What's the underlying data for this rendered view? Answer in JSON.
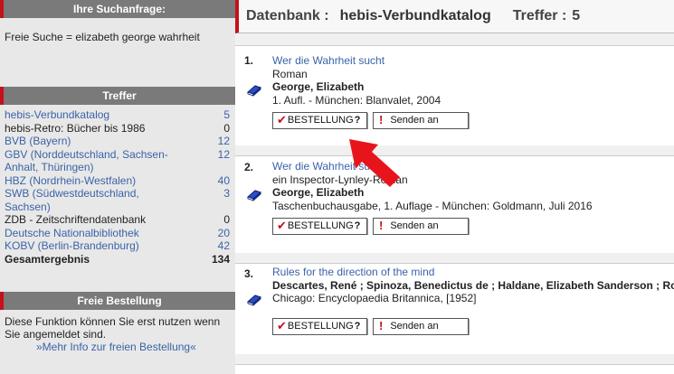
{
  "sidebar": {
    "query_heading": "Ihre Suchanfrage:",
    "query_text": "Freie Suche = elizabeth george wahrheit",
    "treffer_heading": "Treffer",
    "treffer": [
      {
        "label": "hebis-Verbundkatalog",
        "count": "5",
        "link": true
      },
      {
        "label": "hebis-Retro: Bücher bis 1986",
        "count": "0",
        "link": false
      },
      {
        "label": "BVB (Bayern)",
        "count": "12",
        "link": true
      },
      {
        "label": "GBV (Norddeutschland, Sachsen-Anhalt, Thüringen)",
        "count": "12",
        "link": true
      },
      {
        "label": "HBZ (Nordrhein-Westfalen)",
        "count": "40",
        "link": true
      },
      {
        "label": "SWB (Südwestdeutschland, Sachsen)",
        "count": "3",
        "link": true
      },
      {
        "label": "ZDB - Zeitschriftendatenbank",
        "count": "0",
        "link": false
      },
      {
        "label": "Deutsche Nationalbibliothek",
        "count": "20",
        "link": true
      },
      {
        "label": "KOBV (Berlin-Brandenburg)",
        "count": "42",
        "link": true
      }
    ],
    "total_label": "Gesamtergebnis",
    "total_count": "134",
    "freie_heading": "Freie Bestellung",
    "freie_text": "Diese Funktion können Sie erst nutzen wenn Sie angemeldet sind.",
    "freie_link": "»Mehr Info zur freien Bestellung«"
  },
  "header": {
    "db_label": "Datenbank :",
    "db_name": "hebis-Verbundkatalog",
    "hits_label": "Treffer :",
    "hits_count": "5"
  },
  "buttons": {
    "order_label": "BESTELLUNG",
    "order_suffix": "?",
    "send_label": "Senden an"
  },
  "results": [
    {
      "num": "1.",
      "title": "Wer die Wahrheit sucht",
      "subtitle": "Roman",
      "author": "George, Elizabeth",
      "publication": "1. Aufl. - München: Blanvalet, 2004"
    },
    {
      "num": "2.",
      "title": "Wer die Wahrheit sucht",
      "subtitle": "ein Inspector-Lynley-Roman",
      "author": "George, Elizabeth",
      "publication": "Taschenbuchausgabe, 1. Auflage - München: Goldmann, Juli 2016"
    },
    {
      "num": "3.",
      "title": "Rules for the direction of the mind",
      "subtitle": "",
      "author": "Descartes, René ; Spinoza, Benedictus de ; Haldane, Elizabeth Sanderson ; Ross",
      "publication": "Chicago: Encyclopaedia Britannica, [1952]"
    }
  ],
  "icons": {
    "result_icon": "book-icon",
    "order_icon": "checkmark-icon",
    "send_icon": "exclamation-icon",
    "arrow": "red-arrow-icon"
  },
  "colors": {
    "accent_red": "#c4101a",
    "link_blue": "#3a63a8",
    "sidebar_header": "#7a7a7a",
    "sidebar_bg": "#e8e8e8"
  }
}
